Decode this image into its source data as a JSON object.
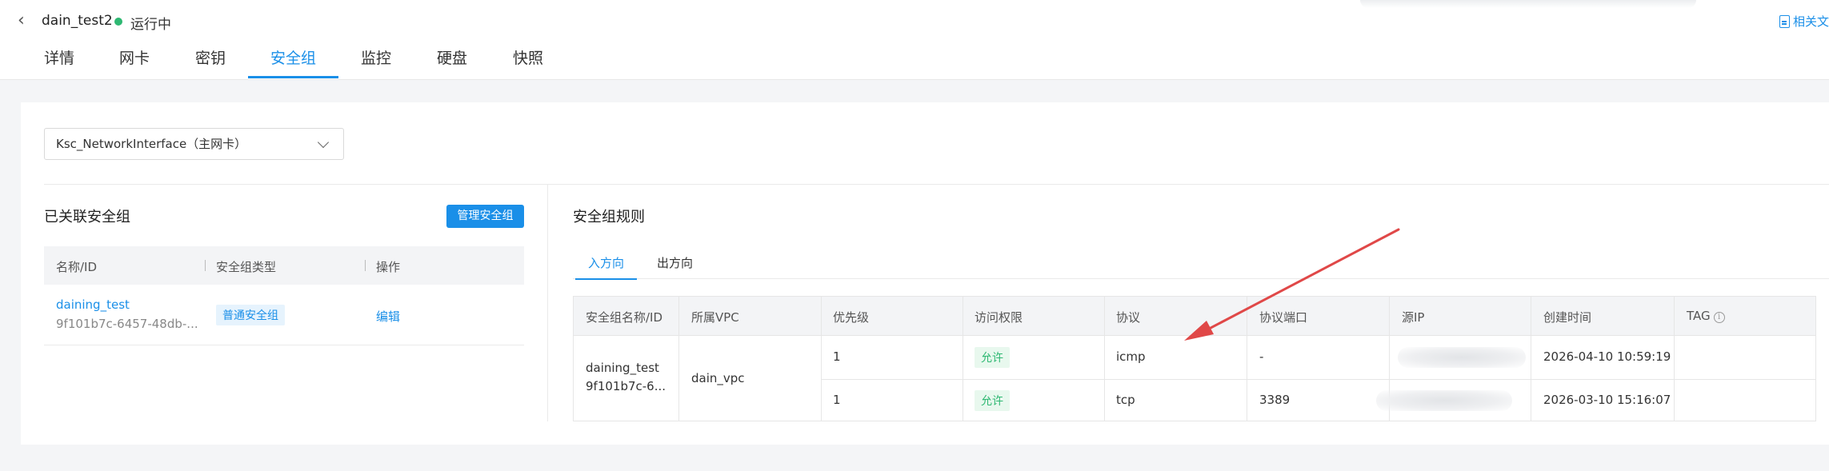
{
  "header": {
    "back_icon": "chevron-left-icon",
    "instance_name": "dain_test2",
    "status": "运行中",
    "status_color": "#2eb872",
    "docs_link": "相关文"
  },
  "tabs": [
    {
      "label": "详情"
    },
    {
      "label": "网卡"
    },
    {
      "label": "密钥"
    },
    {
      "label": "安全组",
      "active": true
    },
    {
      "label": "监控"
    },
    {
      "label": "硬盘"
    },
    {
      "label": "快照"
    }
  ],
  "nic_select": {
    "value": "Ksc_NetworkInterface（主网卡）"
  },
  "associated": {
    "title": "已关联安全组",
    "manage_button": "管理安全组",
    "columns": [
      "名称/ID",
      "安全组类型",
      "操作"
    ],
    "rows": [
      {
        "name": "daining_test",
        "id": "9f101b7c-6457-48db-...",
        "type": "普通安全组",
        "action": "编辑"
      }
    ]
  },
  "rules": {
    "title": "安全组规则",
    "tabs": [
      "入方向",
      "出方向"
    ],
    "columns": [
      "安全组名称/ID",
      "所属VPC",
      "优先级",
      "访问权限",
      "协议",
      "协议端口",
      "源IP",
      "创建时间",
      "TAG"
    ],
    "group": {
      "name": "daining_test",
      "id": "9f101b7c-6...",
      "vpc": "dain_vpc"
    },
    "rows": [
      {
        "priority": "1",
        "permission": "允许",
        "protocol": "icmp",
        "port": "-",
        "created": "2026-04-10 10:59:19"
      },
      {
        "priority": "1",
        "permission": "允许",
        "protocol": "tcp",
        "port": "3389",
        "created": "2026-03-10 15:16:07"
      }
    ]
  },
  "colors": {
    "accent": "#1a8fe8",
    "allow_green": "#2eb872",
    "annotation_arrow": "#e04848"
  }
}
